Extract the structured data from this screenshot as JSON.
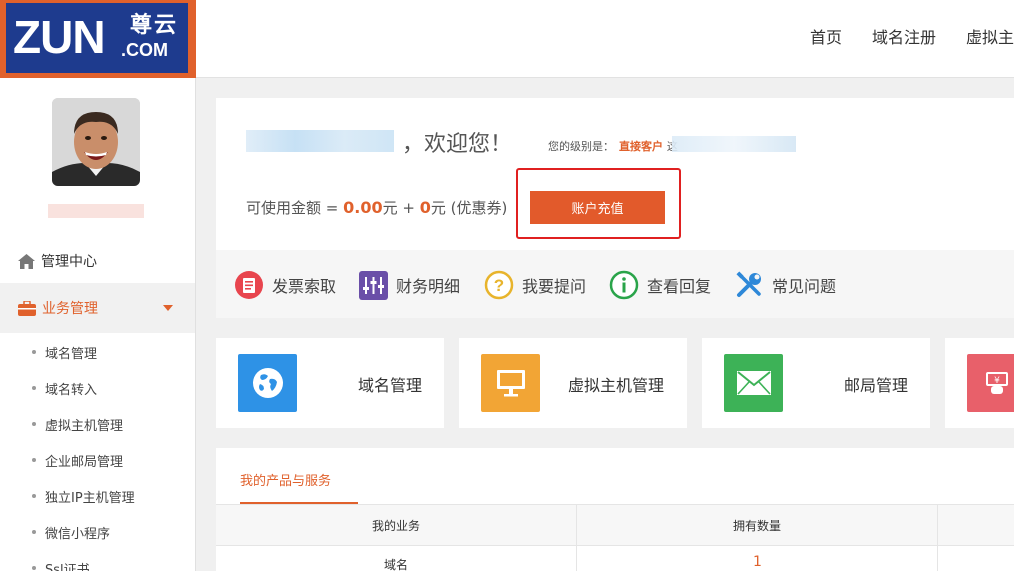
{
  "logo": {
    "brand": "ZUN",
    "cn": "尊云",
    "domain": ".COM"
  },
  "nav": {
    "items": [
      "首页",
      "域名注册",
      "虚拟主"
    ]
  },
  "sidebar": {
    "home_label": "管理中心",
    "biz_label": "业务管理",
    "sub_items": [
      "域名管理",
      "域名转入",
      "虚拟主机管理",
      "企业邮局管理",
      "独立IP主机管理",
      "微信小程序",
      "Ssl证书"
    ]
  },
  "welcome": {
    "greeting": "，欢迎您！",
    "level_label": "您的级别是：",
    "level_value": "直接客户",
    "level_suffix": "这",
    "balance_label": "可使用金额 = ",
    "balance_amount": "0.00",
    "balance_unit1": "元 + ",
    "coupon_amount": "0",
    "balance_unit2": "元 (优惠券)",
    "recharge_button": "账户充值"
  },
  "quick_links": [
    "发票索取",
    "财务明细",
    "我要提问",
    "查看回复",
    "常见问题"
  ],
  "cards": [
    "域名管理",
    "虚拟主机管理",
    "邮局管理"
  ],
  "products": {
    "tab_label": "我的产品与服务",
    "columns": [
      "我的业务",
      "拥有数量"
    ],
    "rows": [
      {
        "name": "域名",
        "count": "1"
      }
    ]
  },
  "colors": {
    "accent": "#e0612c",
    "logo_blue": "#1e3b8e",
    "highlight_red": "#e02020"
  }
}
